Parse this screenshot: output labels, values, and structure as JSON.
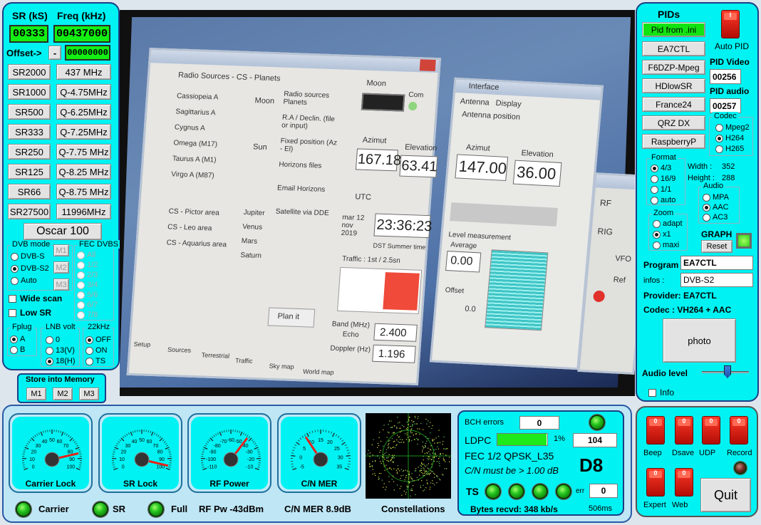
{
  "left": {
    "sr_header": "SR (kS)",
    "freq_header": "Freq (kHz)",
    "sr_value": "00333",
    "freq_value": "00437000",
    "offset_label": "Offset->",
    "offset_sign": "-",
    "offset_value": "00000000",
    "sr_buttons": [
      "SR2000",
      "SR1000",
      "SR500",
      "SR333",
      "SR250",
      "SR125",
      "SR66",
      "SR27500"
    ],
    "freq_buttons": [
      "437 MHz",
      "Q-4.75MHz",
      "Q-6.25MHz",
      "Q-7.25MHz",
      "Q-7.75 MHz",
      "Q-8.25 MHz",
      "Q-8.75 MHz",
      "11996MHz"
    ],
    "oscar_button": "Oscar 100",
    "dvb_mode_title": "DVB mode",
    "dvb_modes": [
      "DVB-S",
      "DVB-S2",
      "Auto"
    ],
    "dvb_mode_selected": "DVB-S2",
    "mem_small": [
      "M1",
      "M2",
      "M3"
    ],
    "fec_title": "FEC DVBS",
    "fec_options": [
      "All",
      "1/2",
      "2/3",
      "3/4",
      "5/6",
      "6/7",
      "7/8"
    ],
    "wide_scan": "Wide scan",
    "low_sr": "Low SR",
    "fplug_title": "Fplug",
    "fplug_options": [
      "A",
      "B"
    ],
    "fplug_selected": "A",
    "lnb_title": "LNB volt",
    "lnb_options": [
      "0",
      "13(V)",
      "18(H)"
    ],
    "lnb_selected": "18(H)",
    "khz_title": "22kHz",
    "khz_options": [
      "OFF",
      "ON",
      "TS"
    ],
    "khz_selected": "OFF",
    "store_title": "Store into Memory",
    "store_buttons": [
      "M1",
      "M2",
      "M3"
    ]
  },
  "right": {
    "pids_title": "PIDs",
    "pid_from_ini": "Pid from .ini",
    "presets": [
      "EA7CTL",
      "F6DZP-Mpeg",
      "HDlowSR",
      "France24",
      "QRZ DX",
      "RaspberryP"
    ],
    "auto_pid": "Auto PID",
    "pid_video_label": "PID Video",
    "pid_video": "00256",
    "pid_audio_label": "PID audio",
    "pid_audio": "00257",
    "codec_title": "Codec",
    "codec_options": [
      "Mpeg2",
      "H264",
      "H265"
    ],
    "codec_selected": "H264",
    "format_title": "Format",
    "format_options": [
      "4/3",
      "16/9",
      "1/1",
      "auto"
    ],
    "format_selected": "4/3",
    "width_label": "Width :",
    "width_value": "352",
    "height_label": "Height :",
    "height_value": "288",
    "audio_title": "Audio",
    "audio_options": [
      "MPA",
      "AAC",
      "AC3"
    ],
    "audio_selected": "AAC",
    "zoom_title": "Zoom",
    "zoom_options": [
      "adapt",
      "x1",
      "maxi"
    ],
    "zoom_selected": "x1",
    "graph_label": "GRAPH",
    "reset": "Reset",
    "program_label": "Program",
    "program_value": "EA7CTL",
    "infos_label": "infos :",
    "infos_value": "DVB-S2",
    "provider": "Provider: EA7CTL",
    "codec_line": "Codec :    VH264 + AAC",
    "photo": "photo",
    "audio_level": "Audio level",
    "audio_level_value": 0.55,
    "info": "Info"
  },
  "bottom": {
    "gauges": [
      {
        "label": "Carrier Lock",
        "ticks": [
          "0",
          "10",
          "20",
          "30",
          "40",
          "50",
          "60",
          "70",
          "80",
          "90",
          "100"
        ],
        "value": 85
      },
      {
        "label": "SR Lock",
        "ticks": [
          "0",
          "10",
          "20",
          "30",
          "40",
          "50",
          "60",
          "70",
          "80",
          "90",
          "100"
        ],
        "value": 97
      },
      {
        "label": "RF Power",
        "ticks": [
          "-110",
          "-100",
          "-90",
          "-80",
          "-70",
          "-60",
          "-50",
          "-40",
          "-30",
          "-20",
          "-10"
        ],
        "value": -43
      },
      {
        "label": "C/N MER",
        "ticks": [
          "-5",
          "0",
          "5",
          "10",
          "15",
          "20",
          "25",
          "30",
          "35"
        ],
        "value": 8.9
      }
    ],
    "status": {
      "carrier": "Carrier",
      "sr": "SR",
      "full": "Full",
      "rf_pw": "RF Pw -43dBm",
      "cn_mer": "C/N MER 8.9dB",
      "constellations": "Constellations"
    },
    "decoder": {
      "bch_label": "BCH errors",
      "bch_value": "0",
      "ldpc_label": "LDPC",
      "ldpc_pct": "1%",
      "ldpc_fill": 0.99,
      "ldpc_value": "104",
      "fec_line": "FEC  1/2 QPSK_L35",
      "cn_line": "C/N must be > 1.00 dB",
      "code": "D8",
      "ts_label": "TS",
      "err_label": "err",
      "err_value": "0",
      "bytes_line": "Bytes recvd:  348 kb/s",
      "ms": "506ms"
    },
    "controls": {
      "toggles": [
        "Beep",
        "Dsave",
        "UDP",
        "Record",
        "Expert",
        "Web"
      ],
      "quit": "Quit"
    }
  },
  "video": {
    "interface": {
      "radio_sources_title": "Radio Sources - CS - Planets",
      "sources": [
        "Cassiopeia A",
        "Sagittarius A",
        "Cygnus A",
        "Omega (M17)",
        "Taurus A (M1)",
        "Virgo A (M87)"
      ],
      "moon": "Moon",
      "sun": "Sun",
      "radio_opts": [
        "Radio sources Planets",
        "R.A / Declin. (file or input)",
        "Fixed position (Az - El)",
        "Horizons files",
        "Email Horizons",
        "Satellite via DDE"
      ],
      "cs_items": [
        "CS - Pictor area",
        "CS - Leo area",
        "CS - Aquarius area"
      ],
      "planets": [
        "Jupiter",
        "Venus",
        "Mars",
        "Saturn"
      ],
      "moon_title": "Moon",
      "azimut": "Azimut",
      "elevation": "Elevation",
      "az_value": "167.18",
      "el_value": "63.41",
      "com": "Com",
      "utc": "UTC",
      "date": "mar 12 nov 2019",
      "time": "23:36:23",
      "dst": "DST Summer time",
      "traffic": "Traffic : 1st / 2.5sn",
      "band": "Band (MHz)",
      "echo": "Echo",
      "doppler": "Doppler (Hz)",
      "band_value": "2.400",
      "doppler_value": "1.196",
      "plan": "Plan it",
      "tabs": [
        "Setup",
        "Sources",
        "Terrestrial",
        "Traffic",
        "Sky map",
        "World map"
      ],
      "window2_title": "Interface",
      "antenna": "Antenna",
      "display": "Display",
      "antenna_pos": "Antenna position",
      "az2": "147.00",
      "el2": "36.00",
      "level": "Level measurement",
      "average": "Average",
      "avg_value": "0.00",
      "offset": "Offset",
      "offset_value": "0.0",
      "rf": "RF",
      "rig": "RIG",
      "vfo": "VFO",
      "ref": "Ref"
    }
  }
}
